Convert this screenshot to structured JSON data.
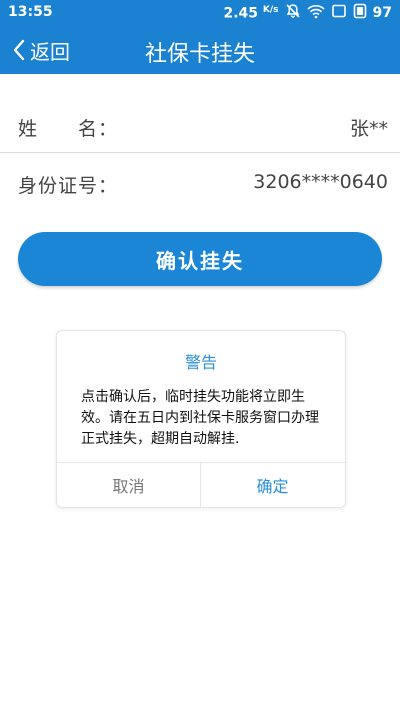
{
  "status_bar": {
    "time": "13:55",
    "net_speed": "2.45",
    "net_speed_unit": "K/s",
    "battery": "97",
    "icons": [
      "mute-icon",
      "wifi-icon",
      "battery-icon"
    ]
  },
  "nav": {
    "back_label": "返回",
    "title": "社保卡挂失"
  },
  "form": {
    "name_label": "姓　　名：",
    "name_value": "张**",
    "id_label": "身份证号：",
    "id_value": "3206****0640"
  },
  "confirm_button": "确认挂失",
  "dialog": {
    "title": "警告",
    "message": "点击确认后，临时挂失功能将立即生效。请在五日内到社保卡服务窗口办理正式挂失，超期自动解挂.",
    "cancel": "取消",
    "ok": "确定"
  },
  "colors": {
    "header": "#1a82d0",
    "accent": "#2a8fd6",
    "button": "#1b86d6"
  }
}
